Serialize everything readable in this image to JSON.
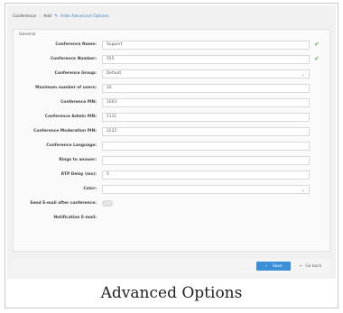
{
  "breadcrumb": {
    "root": "Conference",
    "separator": "›",
    "current": "Add",
    "advanced_link": "Hide Advanced Options"
  },
  "form": {
    "section_title": "General",
    "fields": [
      {
        "label": "Conference Name:",
        "value": "Support",
        "type": "text",
        "valid": true
      },
      {
        "label": "Conference Number:",
        "value": "555",
        "type": "text",
        "valid": true
      },
      {
        "label": "Conference Group:",
        "value": "Default",
        "type": "select"
      },
      {
        "label": "Maximum number of users:",
        "value": "10",
        "type": "text"
      },
      {
        "label": "Conference PIN:",
        "value": "1003",
        "type": "text"
      },
      {
        "label": "Conference Admin PIN:",
        "value": "1111",
        "type": "text"
      },
      {
        "label": "Conference Moderation PIN:",
        "value": "2222",
        "type": "text"
      },
      {
        "label": "Conference Language:",
        "value": "",
        "type": "text"
      },
      {
        "label": "Rings to answer:",
        "value": "",
        "type": "text"
      },
      {
        "label": "RTP Delay (ms):",
        "value": "5",
        "type": "text"
      },
      {
        "label": "Color:",
        "value": "",
        "type": "select"
      },
      {
        "label": "Send E-mail after conference:",
        "value": "",
        "type": "toggle"
      },
      {
        "label": "Notification E-mail:",
        "value": "",
        "type": "text"
      }
    ]
  },
  "footer": {
    "save_label": "Save",
    "back_label": "Go back"
  },
  "caption": "Advanced Options",
  "colors": {
    "accent": "#3a8fd6",
    "valid": "#5cb85c"
  }
}
